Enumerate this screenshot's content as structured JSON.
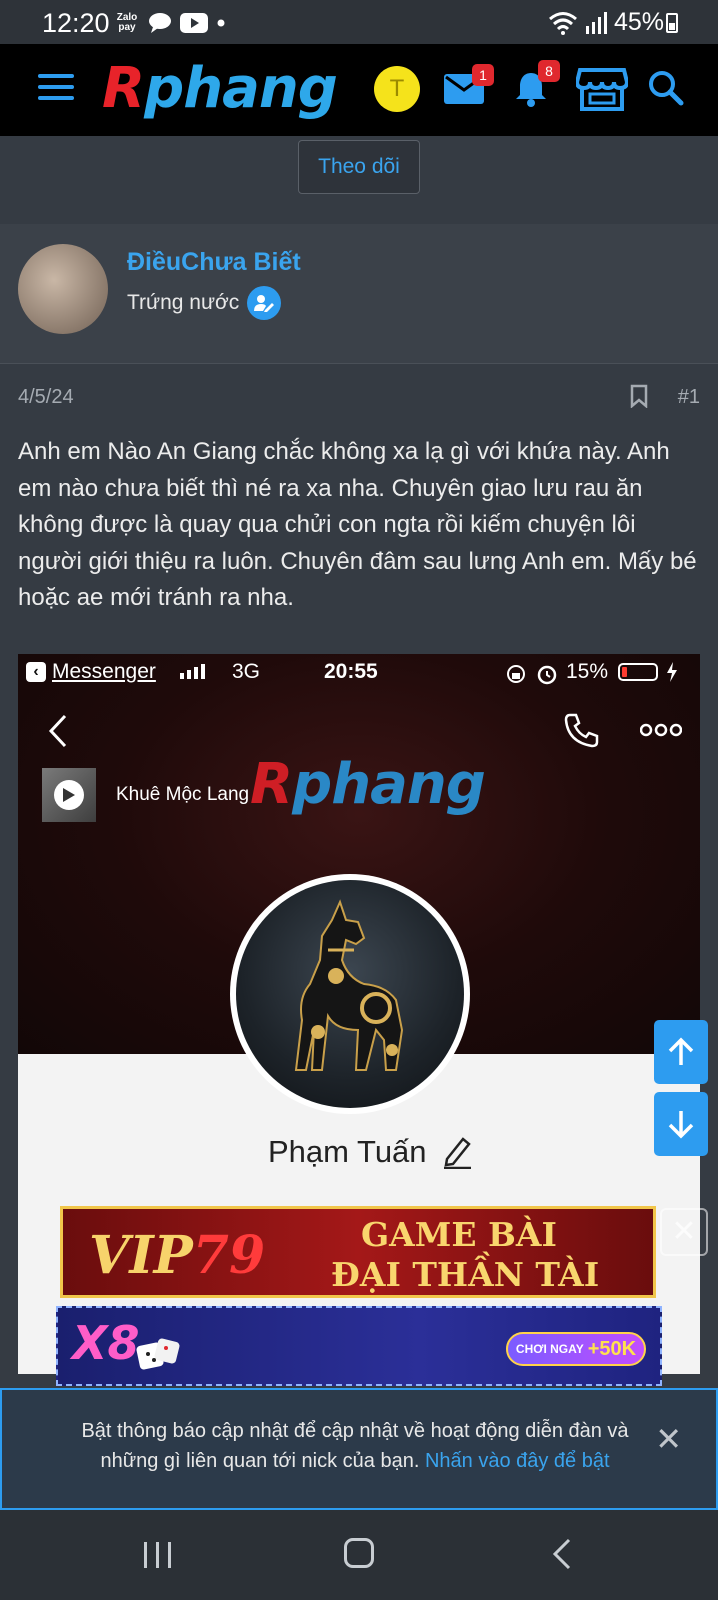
{
  "status_bar": {
    "time": "12:20",
    "zalo_label": "Zalo pay",
    "battery": "45%"
  },
  "header": {
    "logo_first": "R",
    "logo_rest": "phang",
    "avatar_letter": "T",
    "messages_badge": "1",
    "alerts_badge": "8",
    "colors": {
      "accent": "#2d9cf0",
      "logo_red": "#e8232a",
      "logo_blue": "#2ea8ea",
      "avatar_bg": "#f5e31b"
    }
  },
  "follow_button": "Theo dõi",
  "user": {
    "name": "ĐiềuChưa Biết",
    "title": "Trứng nước"
  },
  "post": {
    "date": "4/5/24",
    "number": "#1",
    "body": "Anh em Nào An Giang chắc không xa lạ gì với khứa này. Anh em nào chưa biết thì né ra xa nha. Chuyên giao lưu rau ăn không được là quay qua chửi con ngta rồi kiếm chuyện lôi người giới thiệu ra luôn. Chuyên đâm sau lưng Anh em. Mấy bé hoặc ae mới tránh ra nha."
  },
  "embedded_screenshot": {
    "back_app": "Messenger",
    "network": "3G",
    "time": "20:55",
    "battery": "15%",
    "music_title": "Khuê Mộc Lang",
    "watermark_first": "R",
    "watermark_rest": "phang",
    "profile_name": "Phạm Tuấn"
  },
  "ads": {
    "vip_brand_a": "VIP",
    "vip_brand_b": "79",
    "vip_line1": "GAME BÀI",
    "vip_line2": "ĐẠI THẦN TÀI",
    "close_symbol": "✕",
    "x8_brand": "X8",
    "x8_cta_label": "CHƠI NGAY",
    "x8_cta_bonus": "+50K"
  },
  "notification": {
    "text": "Bật thông báo cập nhật để cập nhật về hoạt động diễn đàn và những gì liên quan tới nick của bạn.",
    "link": "Nhấn vào đây để bật",
    "close_symbol": "✕"
  },
  "icons": [
    "menu-icon",
    "mail-icon",
    "bell-icon",
    "store-icon",
    "search-icon",
    "verified-icon",
    "bookmark-icon",
    "arrow-up-icon",
    "arrow-down-icon",
    "close-icon",
    "nav-recents-icon",
    "nav-home-icon",
    "nav-back-icon"
  ]
}
